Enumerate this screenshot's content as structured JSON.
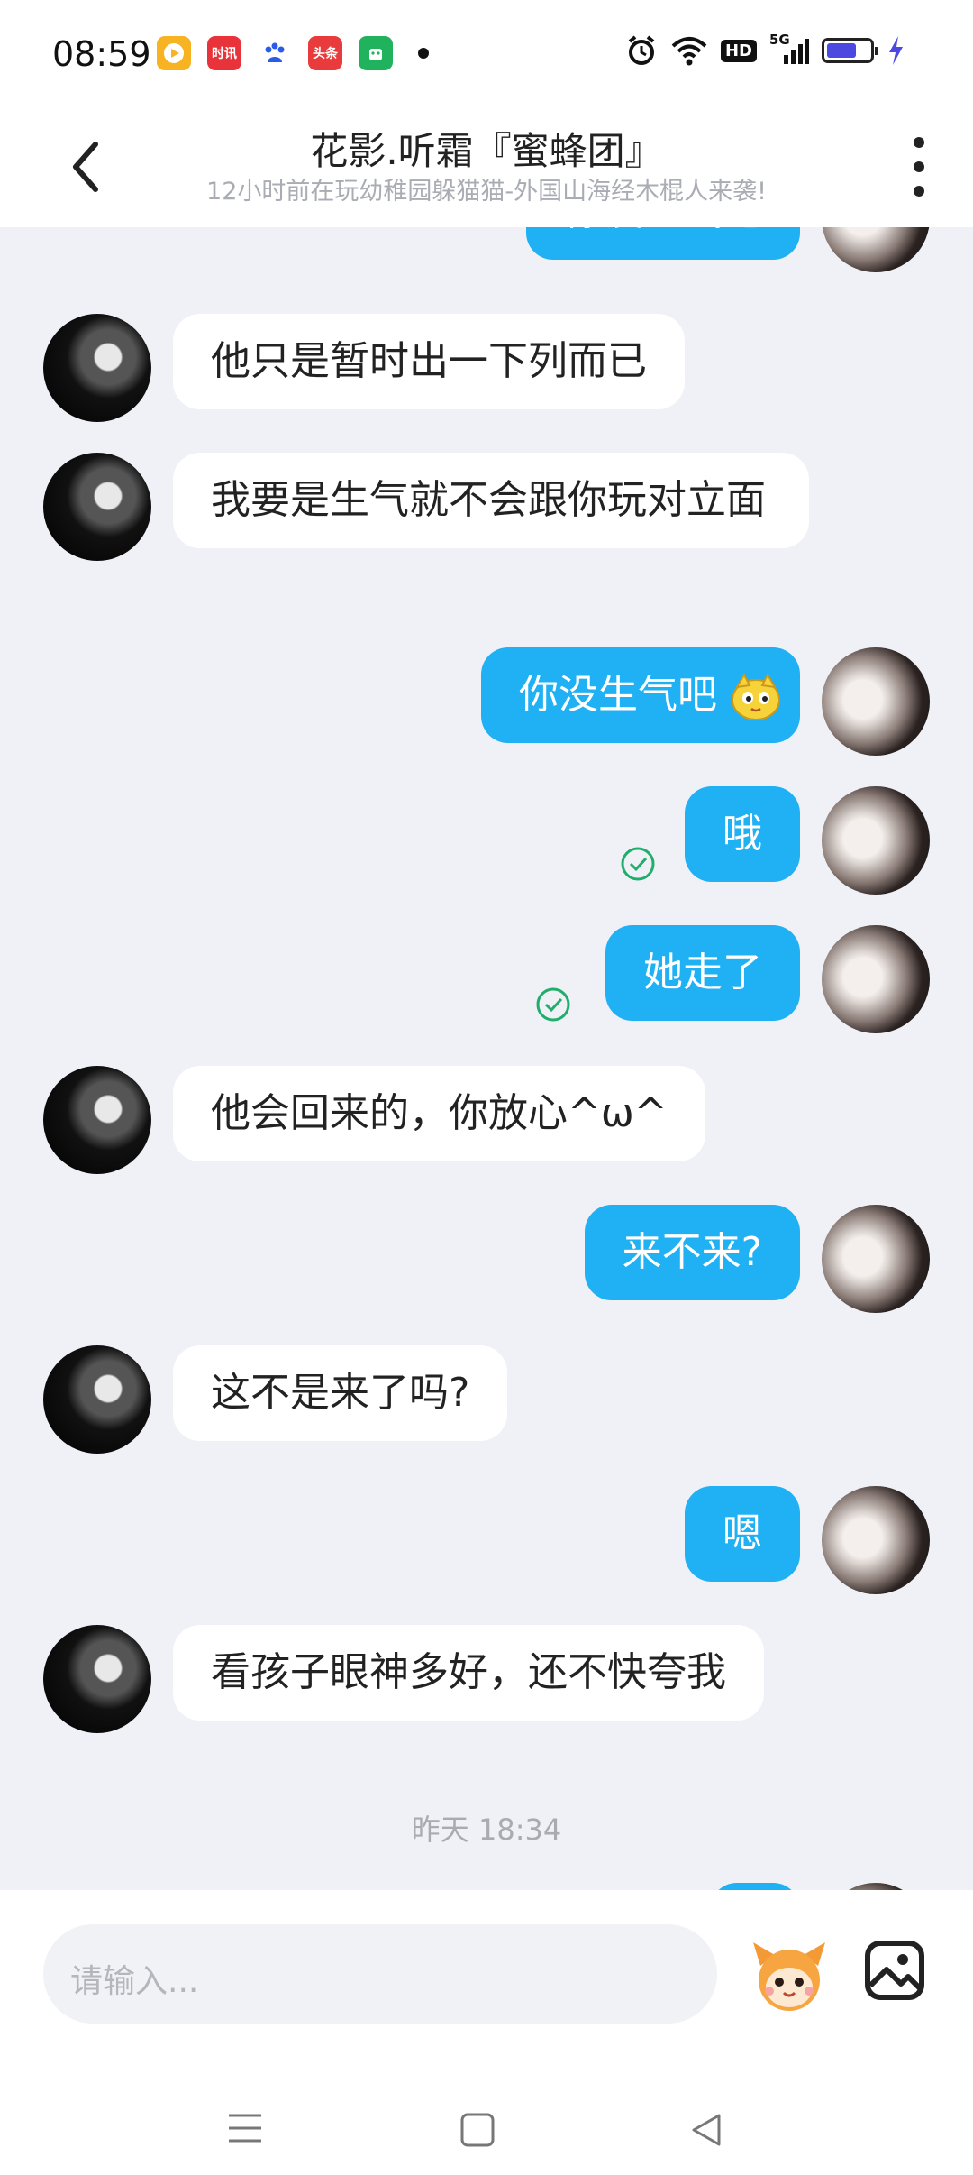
{
  "status_bar": {
    "time": "08:59",
    "app_icons": [
      {
        "name": "video-app-icon",
        "color": "#f7b322",
        "text": ""
      },
      {
        "name": "news-app-icon",
        "color": "#e8333a",
        "text": "时讯"
      },
      {
        "name": "baidu-icon",
        "color": "#ffffff",
        "text": ""
      },
      {
        "name": "toutiao-icon",
        "color": "#e93b3b",
        "text": "头条"
      },
      {
        "name": "green-app-icon",
        "color": "#21b25d",
        "text": ""
      }
    ],
    "hd_label": "HD",
    "network_label": "5G",
    "battery_level": 0.7
  },
  "header": {
    "title": "花影.听霜『蜜蜂团』",
    "subtitle": "12小时前在玩幼稚园躲猫猫-外国山海经木棍人来袭!"
  },
  "messages": [
    {
      "side": "right",
      "text": "你没生气吧",
      "partial": true
    },
    {
      "side": "left",
      "text": "他只是暂时出一下列而已"
    },
    {
      "side": "left",
      "text": "我要是生气就不会跟你玩对立面"
    },
    {
      "side": "right",
      "text": "你没生气吧"
    },
    {
      "side": "right",
      "text": "哦",
      "read": true
    },
    {
      "side": "right",
      "text": "她走了",
      "read": true
    },
    {
      "side": "left",
      "text": "他会回来的，你放心^ω^"
    },
    {
      "side": "right",
      "text": "来不来?"
    },
    {
      "side": "left",
      "text": "这不是来了吗?"
    },
    {
      "side": "right",
      "text": "嗯"
    },
    {
      "side": "left",
      "text": "看孩子眼神多好，还不快夸我"
    }
  ],
  "timestamp": "昨天 18:34",
  "input": {
    "placeholder": "请输入..."
  },
  "colors": {
    "bubble_self": "#20b0f4",
    "bubble_other": "#ffffff",
    "background": "#eff1f6",
    "read_check": "#1fae6b"
  }
}
